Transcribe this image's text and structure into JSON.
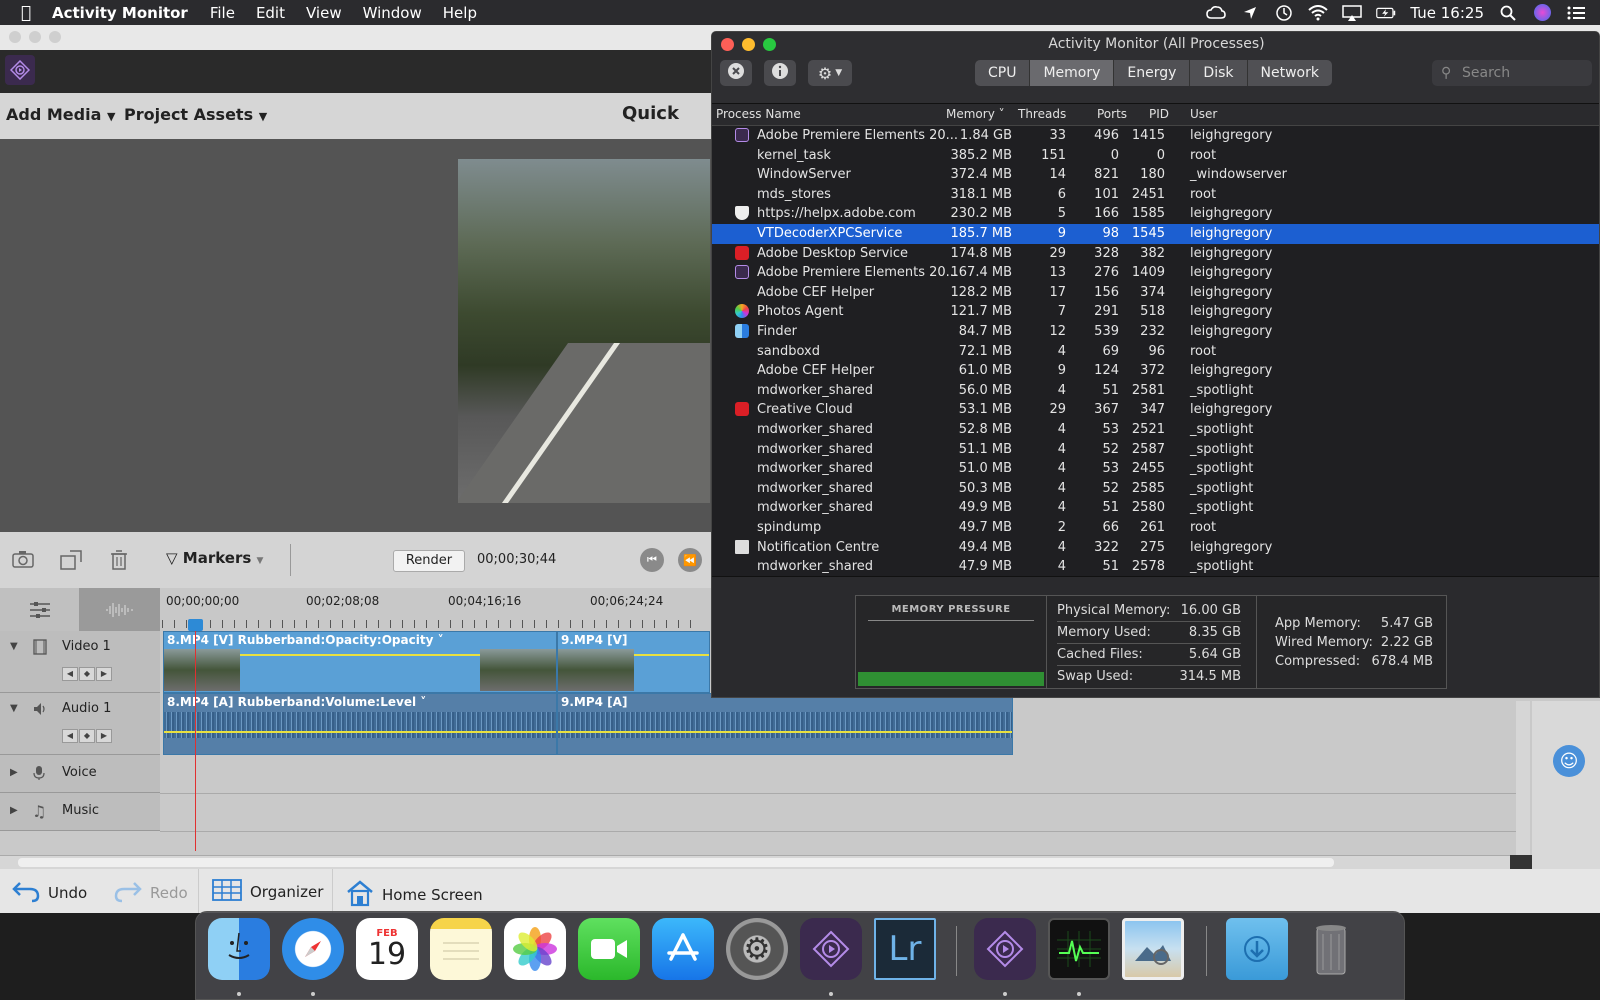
{
  "menubar": {
    "app_name": "Activity Monitor",
    "menus": [
      "File",
      "Edit",
      "View",
      "Window",
      "Help"
    ],
    "clock": "Tue 16:25"
  },
  "premiere": {
    "add_media": "Add Media",
    "project_assets": "Project Assets",
    "quick": "Quick",
    "markers": "Markers",
    "render": "Render",
    "duration": "00;00;30;44",
    "ruler_ticks": [
      "00;00;00;00",
      "00;02;08;08",
      "00;04;16;16",
      "00;06;24;24"
    ],
    "tracks": {
      "video1": "Video 1",
      "audio1": "Audio 1",
      "voice": "Voice",
      "music": "Music"
    },
    "clips": {
      "v1a": "8.MP4 [V] Rubberband:Opacity:Opacity ˅",
      "v1b": "9.MP4 [V]",
      "a1a": "8.MP4 [A] Rubberband:Volume:Level ˅",
      "a1b": "9.MP4 [A]"
    },
    "bottom": {
      "undo": "Undo",
      "redo": "Redo",
      "organizer": "Organizer",
      "home_screen": "Home Screen"
    }
  },
  "activity_monitor": {
    "title": "Activity Monitor (All Processes)",
    "tabs": [
      "CPU",
      "Memory",
      "Energy",
      "Disk",
      "Network"
    ],
    "active_tab": "Memory",
    "search_placeholder": "Search",
    "columns": {
      "name": "Process Name",
      "memory": "Memory ˅",
      "threads": "Threads",
      "ports": "Ports",
      "pid": "PID",
      "user": "User"
    },
    "processes": [
      {
        "name": "Adobe Premiere Elements 20...",
        "memory": "1.84 GB",
        "threads": "33",
        "ports": "496",
        "pid": "1415",
        "user": "leighgregory",
        "icon": "premiere-icon"
      },
      {
        "name": "kernel_task",
        "memory": "385.2 MB",
        "threads": "151",
        "ports": "0",
        "pid": "0",
        "user": "root",
        "icon": ""
      },
      {
        "name": "WindowServer",
        "memory": "372.4 MB",
        "threads": "14",
        "ports": "821",
        "pid": "180",
        "user": "_windowserver",
        "icon": ""
      },
      {
        "name": "mds_stores",
        "memory": "318.1 MB",
        "threads": "6",
        "ports": "101",
        "pid": "2451",
        "user": "root",
        "icon": ""
      },
      {
        "name": "https://helpx.adobe.com",
        "memory": "230.2 MB",
        "threads": "5",
        "ports": "166",
        "pid": "1585",
        "user": "leighgregory",
        "icon": "shield-icon"
      },
      {
        "name": "VTDecoderXPCService",
        "memory": "185.7 MB",
        "threads": "9",
        "ports": "98",
        "pid": "1545",
        "user": "leighgregory",
        "icon": "",
        "selected": true
      },
      {
        "name": "Adobe Desktop Service",
        "memory": "174.8 MB",
        "threads": "29",
        "ports": "328",
        "pid": "382",
        "user": "leighgregory",
        "icon": "creative-cloud-icon"
      },
      {
        "name": "Adobe Premiere Elements 20...",
        "memory": "167.4 MB",
        "threads": "13",
        "ports": "276",
        "pid": "1409",
        "user": "leighgregory",
        "icon": "premiere-icon"
      },
      {
        "name": "Adobe CEF Helper",
        "memory": "128.2 MB",
        "threads": "17",
        "ports": "156",
        "pid": "374",
        "user": "leighgregory",
        "icon": ""
      },
      {
        "name": "Photos Agent",
        "memory": "121.7 MB",
        "threads": "7",
        "ports": "291",
        "pid": "518",
        "user": "leighgregory",
        "icon": "photos-icon"
      },
      {
        "name": "Finder",
        "memory": "84.7 MB",
        "threads": "12",
        "ports": "539",
        "pid": "232",
        "user": "leighgregory",
        "icon": "finder-icon"
      },
      {
        "name": "sandboxd",
        "memory": "72.1 MB",
        "threads": "4",
        "ports": "69",
        "pid": "96",
        "user": "root",
        "icon": ""
      },
      {
        "name": "Adobe CEF Helper",
        "memory": "61.0 MB",
        "threads": "9",
        "ports": "124",
        "pid": "372",
        "user": "leighgregory",
        "icon": ""
      },
      {
        "name": "mdworker_shared",
        "memory": "56.0 MB",
        "threads": "4",
        "ports": "51",
        "pid": "2581",
        "user": "_spotlight",
        "icon": ""
      },
      {
        "name": "Creative Cloud",
        "memory": "53.1 MB",
        "threads": "29",
        "ports": "367",
        "pid": "347",
        "user": "leighgregory",
        "icon": "creative-cloud-icon"
      },
      {
        "name": "mdworker_shared",
        "memory": "52.8 MB",
        "threads": "4",
        "ports": "53",
        "pid": "2521",
        "user": "_spotlight",
        "icon": ""
      },
      {
        "name": "mdworker_shared",
        "memory": "51.1 MB",
        "threads": "4",
        "ports": "52",
        "pid": "2587",
        "user": "_spotlight",
        "icon": ""
      },
      {
        "name": "mdworker_shared",
        "memory": "51.0 MB",
        "threads": "4",
        "ports": "53",
        "pid": "2455",
        "user": "_spotlight",
        "icon": ""
      },
      {
        "name": "mdworker_shared",
        "memory": "50.3 MB",
        "threads": "4",
        "ports": "52",
        "pid": "2585",
        "user": "_spotlight",
        "icon": ""
      },
      {
        "name": "mdworker_shared",
        "memory": "49.9 MB",
        "threads": "4",
        "ports": "51",
        "pid": "2580",
        "user": "_spotlight",
        "icon": ""
      },
      {
        "name": "spindump",
        "memory": "49.7 MB",
        "threads": "2",
        "ports": "66",
        "pid": "261",
        "user": "root",
        "icon": ""
      },
      {
        "name": "Notification Centre",
        "memory": "49.4 MB",
        "threads": "4",
        "ports": "322",
        "pid": "275",
        "user": "leighgregory",
        "icon": "notification-icon"
      },
      {
        "name": "mdworker_shared",
        "memory": "47.9 MB",
        "threads": "4",
        "ports": "51",
        "pid": "2578",
        "user": "_spotlight",
        "icon": ""
      }
    ],
    "memory_pressure_label": "MEMORY PRESSURE",
    "stats": [
      {
        "k": "Physical Memory:",
        "v": "16.00 GB"
      },
      {
        "k": "Memory Used:",
        "v": "8.35 GB"
      },
      {
        "k": "Cached Files:",
        "v": "5.64 GB"
      },
      {
        "k": "Swap Used:",
        "v": "314.5 MB"
      }
    ],
    "stats2": [
      {
        "k": "App Memory:",
        "v": "5.47 GB"
      },
      {
        "k": "Wired Memory:",
        "v": "2.22 GB"
      },
      {
        "k": "Compressed:",
        "v": "678.4 MB"
      }
    ]
  },
  "dock": {
    "calendar_month": "FEB",
    "calendar_day": "19",
    "lightroom": "Lr"
  }
}
